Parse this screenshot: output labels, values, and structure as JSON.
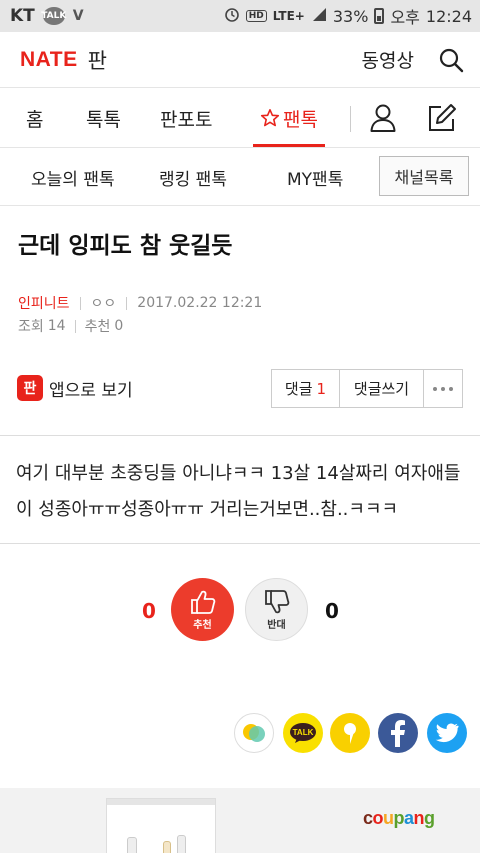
{
  "status_bar": {
    "carrier": "KT",
    "talk_badge": "TALK",
    "v_badge": "V",
    "network": "LTE+",
    "battery": "33%",
    "ampm": "오후",
    "time": "12:24",
    "hd": "HD"
  },
  "header": {
    "logo": "NATE",
    "section": "판",
    "video": "동영상"
  },
  "nav": {
    "items": [
      {
        "label": "홈"
      },
      {
        "label": "톡톡"
      },
      {
        "label": "판포토"
      },
      {
        "label": "팬톡"
      }
    ],
    "active_index": 3
  },
  "subnav": {
    "items": [
      {
        "label": "오늘의 팬톡"
      },
      {
        "label": "랭킹 팬톡"
      },
      {
        "label": "MY팬톡"
      }
    ],
    "channel_button": "채널목록"
  },
  "article": {
    "title": "근데 잉피도 참 웃길듯",
    "author": "인피니트",
    "nickname": "ㅇㅇ",
    "datetime": "2017.02.22 12:21",
    "views_label": "조회",
    "views": "14",
    "recommend_label": "추천",
    "recommend": "0",
    "body": "여기 대부분 초중딩들 아니냐ㅋㅋ 13살 14살짜리 여자애들이 성종아ㅠㅠ성종아ㅠㅠ 거리는거보면..참..ㅋㅋㅋ"
  },
  "actions": {
    "app_icon_text": "판",
    "app_view": "앱으로 보기",
    "comments_label": "댓글",
    "comments_count": "1",
    "write_comment": "댓글쓰기"
  },
  "votes": {
    "up_count": "0",
    "up_label": "추천",
    "down_label": "반대",
    "down_count": "0"
  },
  "share": {
    "icons": [
      "kakaostory-icon",
      "kakaotalk-icon",
      "kakaopage-icon",
      "facebook-icon",
      "twitter-icon"
    ],
    "talk_text": "TALK"
  },
  "ad": {
    "brand": [
      "c",
      "o",
      "u",
      "p",
      "a",
      "n",
      "g"
    ]
  },
  "colors": {
    "accent": "#e8231b",
    "facebook": "#3b5998",
    "twitter": "#1da1f2",
    "kakao": "#f9e000"
  }
}
